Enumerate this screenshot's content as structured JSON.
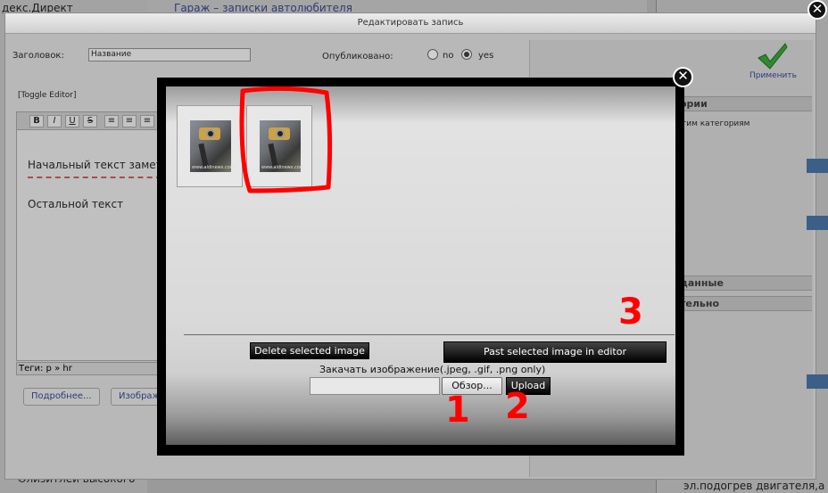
{
  "background_page": {
    "left_top_text": "декс.Директ",
    "mid_link": "Гараж – записки автолюбителя",
    "left_bottom_text": "Олизитлей высокого",
    "right_bottom_text": "эл.подогрев двигателя,а"
  },
  "edit_window": {
    "title": "Редактировать запись",
    "close_glyph": "✕",
    "title_label": "Заголовок:",
    "title_value": "Название",
    "published_label": "Опубликовано:",
    "radio_no": "no",
    "radio_yes": "yes",
    "published_value": "yes",
    "toggle_editor": "[Toggle Editor]",
    "toolbar_buttons": [
      "B",
      "I",
      "U",
      "S",
      "≡",
      "≡",
      "≡"
    ],
    "body_line1": "Начальный текст заметки",
    "body_line2": "Остальной текст",
    "tags": "Теги: p » hr",
    "more_button": "Подробнее...",
    "image_button": "Изображ",
    "apply_label": "Применить",
    "right_sections": [
      "ории",
      "тим категориям",
      "данные",
      "тельно"
    ]
  },
  "image_modal": {
    "close_glyph": "✕",
    "thumbnails": [
      {
        "selected": false,
        "watermark": "www.aldinews.com"
      },
      {
        "selected": true,
        "watermark": "www.aldinews.com"
      }
    ],
    "delete_button": "Delete selected image",
    "paste_button": "Past selected image in editor",
    "upload_label": "Закачать изображение(.jpeg, .gif, .png only)",
    "file_value": "",
    "browse_button": "Обзор...",
    "upload_button": "Upload"
  },
  "annotations": {
    "color": "#ff0000",
    "numbers": [
      "1",
      "2",
      "3"
    ]
  }
}
